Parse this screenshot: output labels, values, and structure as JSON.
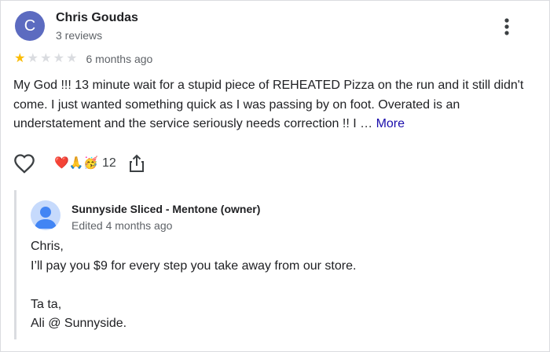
{
  "review": {
    "avatar_letter": "C",
    "avatar_color": "#5c6bc0",
    "author": "Chris Goudas",
    "meta": "3 reviews",
    "rating": 1,
    "rating_max": 5,
    "time": "6 months ago",
    "text": "My God !!! 13 minute wait for a stupid piece of REHEATED Pizza on the run and it still didn't come. I just wanted something quick as I was passing by on foot. Overated is an understatement and the service seriously needs correction !! I …",
    "more_label": "More",
    "reaction_emojis": "❤️🙏🥳",
    "reaction_count": "12",
    "icons": {
      "more": "more-vert-icon",
      "like": "heart-outline-icon",
      "share": "share-icon"
    }
  },
  "owner_reply": {
    "name": "Sunnyside Sliced - Mentone (owner)",
    "edited": "Edited 4 months ago",
    "avatar_color": "#c6dafc",
    "lines": [
      "Chris,",
      "I’ll pay you $9 for every step you take away from our store.",
      "",
      "Ta ta,",
      "Ali @ Sunnyside."
    ]
  },
  "colors": {
    "star_filled": "#fbbc04",
    "star_empty": "#dadce0",
    "link": "#1a0dab",
    "secondary_text": "#5f6368",
    "divider": "#dadce0"
  }
}
